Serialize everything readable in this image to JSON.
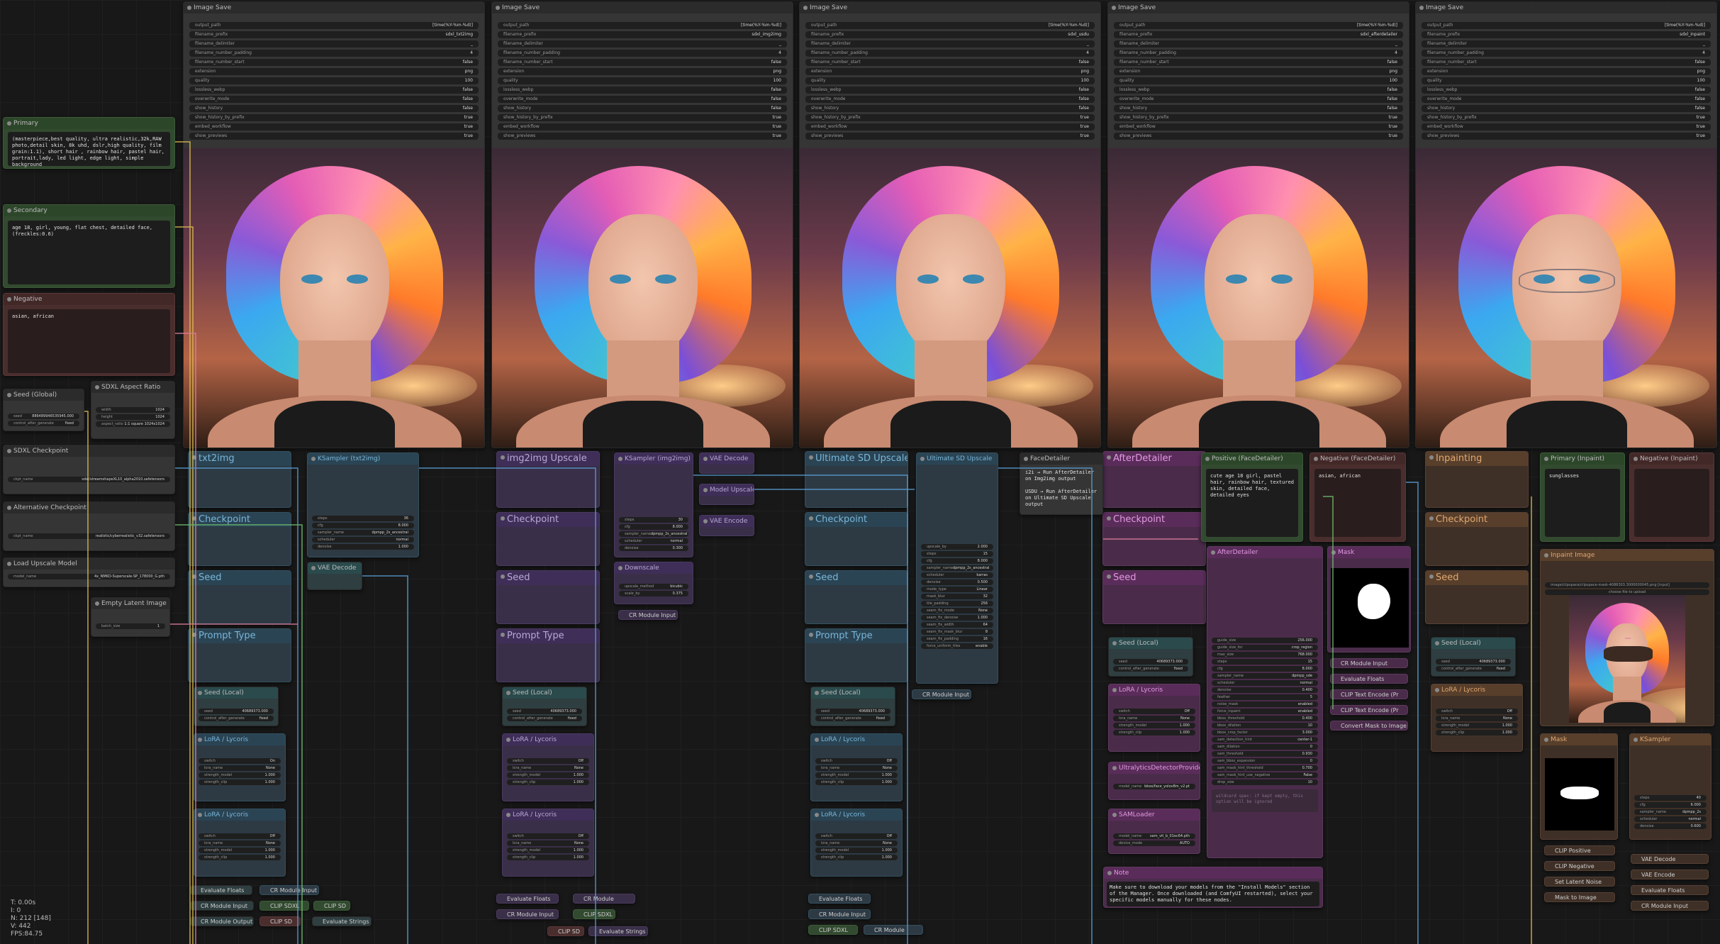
{
  "colors": {
    "canvas": "#181818",
    "link_yellow": "#e0c050",
    "link_blue": "#5aa0d8",
    "link_pink": "#e080a0",
    "link_green": "#70c070"
  },
  "image_saves": [
    {
      "title": "Image Save",
      "rows": [
        [
          "output_path",
          "[time(%Y-%m-%d)]"
        ],
        [
          "filename_prefix",
          "sdxl_txt2img"
        ],
        [
          "filename_delimiter",
          "_"
        ],
        [
          "filename_number_padding",
          "4"
        ],
        [
          "filename_number_start",
          "false"
        ],
        [
          "extension",
          "png"
        ],
        [
          "quality",
          "100"
        ],
        [
          "lossless_webp",
          "false"
        ],
        [
          "overwrite_mode",
          "false"
        ],
        [
          "show_history",
          "false"
        ],
        [
          "show_history_by_prefix",
          "true"
        ],
        [
          "embed_workflow",
          "true"
        ],
        [
          "show_previews",
          "true"
        ]
      ]
    },
    {
      "title": "Image Save",
      "rows": [
        [
          "output_path",
          "[time(%Y-%m-%d)]"
        ],
        [
          "filename_prefix",
          "sdxl_img2img"
        ],
        [
          "filename_delimiter",
          "_"
        ],
        [
          "filename_number_padding",
          "4"
        ],
        [
          "filename_number_start",
          "false"
        ],
        [
          "extension",
          "png"
        ],
        [
          "quality",
          "100"
        ],
        [
          "lossless_webp",
          "false"
        ],
        [
          "overwrite_mode",
          "false"
        ],
        [
          "show_history",
          "false"
        ],
        [
          "show_history_by_prefix",
          "true"
        ],
        [
          "embed_workflow",
          "true"
        ],
        [
          "show_previews",
          "true"
        ]
      ]
    },
    {
      "title": "Image Save",
      "rows": [
        [
          "output_path",
          "[time(%Y-%m-%d)]"
        ],
        [
          "filename_prefix",
          "sdxl_usdu"
        ],
        [
          "filename_delimiter",
          "_"
        ],
        [
          "filename_number_padding",
          "4"
        ],
        [
          "filename_number_start",
          "false"
        ],
        [
          "extension",
          "png"
        ],
        [
          "quality",
          "100"
        ],
        [
          "lossless_webp",
          "false"
        ],
        [
          "overwrite_mode",
          "false"
        ],
        [
          "show_history",
          "false"
        ],
        [
          "show_history_by_prefix",
          "true"
        ],
        [
          "embed_workflow",
          "true"
        ],
        [
          "show_previews",
          "true"
        ]
      ]
    },
    {
      "title": "Image Save",
      "rows": [
        [
          "output_path",
          "[time(%Y-%m-%d)]"
        ],
        [
          "filename_prefix",
          "sdxl_afterdetailer"
        ],
        [
          "filename_delimiter",
          "_"
        ],
        [
          "filename_number_padding",
          "4"
        ],
        [
          "filename_number_start",
          "false"
        ],
        [
          "extension",
          "png"
        ],
        [
          "quality",
          "100"
        ],
        [
          "lossless_webp",
          "false"
        ],
        [
          "overwrite_mode",
          "false"
        ],
        [
          "show_history",
          "false"
        ],
        [
          "show_history_by_prefix",
          "true"
        ],
        [
          "embed_workflow",
          "true"
        ],
        [
          "show_previews",
          "true"
        ]
      ]
    },
    {
      "title": "Image Save",
      "rows": [
        [
          "output_path",
          "[time(%Y-%m-%d)]"
        ],
        [
          "filename_prefix",
          "sdxl_inpaint"
        ],
        [
          "filename_delimiter",
          "_"
        ],
        [
          "filename_number_padding",
          "4"
        ],
        [
          "filename_number_start",
          "false"
        ],
        [
          "extension",
          "png"
        ],
        [
          "quality",
          "100"
        ],
        [
          "lossless_webp",
          "false"
        ],
        [
          "overwrite_mode",
          "false"
        ],
        [
          "show_history",
          "false"
        ],
        [
          "show_history_by_prefix",
          "true"
        ],
        [
          "embed_workflow",
          "true"
        ],
        [
          "show_previews",
          "true"
        ]
      ]
    }
  ],
  "prompts": {
    "primary": {
      "title": "Primary",
      "text": "(masterpiece,best quality, ultra realistic,32k,RAW photo,detail skin, 8k uhd, dslr,high quality, film grain:1.1), short hair , rainbow hair, pastel hair, portrait,lady, led light, edge light, simple background"
    },
    "secondary": {
      "title": "Secondary",
      "text": "age 18, girl, young, flat chest, detailed face, (freckles:0.6)"
    },
    "negative": {
      "title": "Negative",
      "text": "asian, african"
    }
  },
  "left_nodes": {
    "seed_global": {
      "title": "Seed (Global)",
      "rows": [
        [
          "seed",
          "886489946535945.000"
        ],
        [
          "control_after_generate",
          "fixed"
        ]
      ]
    },
    "aspect": {
      "title": "SDXL Aspect Ratio",
      "rows": [
        [
          "width",
          "1024"
        ],
        [
          "height",
          "1024"
        ],
        [
          "aspect_ratio",
          "1:1 square 1024x1024"
        ]
      ]
    },
    "checkpoint": {
      "title": "SDXL Checkpoint",
      "rows": [
        [
          "ckpt_name",
          "sdxl/streamshapeXL10_alpha2010.safetensors"
        ]
      ]
    },
    "alt_checkpoint": {
      "title": "Alternative Checkpoint",
      "rows": [
        [
          "ckpt_name",
          "realistic/cyberrealistic_v32.safetensors"
        ]
      ]
    },
    "upscale_model": {
      "title": "Load Upscale Model",
      "rows": [
        [
          "model_name",
          "4x_NMKD-Superscale-SP_178000_G.pth"
        ]
      ]
    },
    "empty_latent": {
      "title": "Empty Latent Image",
      "rows": [
        [
          "batch_size",
          "1"
        ]
      ]
    }
  },
  "groups": {
    "txt2img": "txt2img",
    "img2img": "img2img Upscale",
    "usdu": "Ultimate SD Upscale",
    "afterdetailer": "AfterDetailer",
    "inpainting": "Inpainting",
    "checkpoint": "Checkpoint",
    "seed": "Seed",
    "prompt_type": "Prompt Type"
  },
  "ksampler_txt2img": {
    "title": "KSampler (txt2img)",
    "rows": [
      [
        "steps",
        "36"
      ],
      [
        "cfg",
        "8.000"
      ],
      [
        "sampler_name",
        "dpmpp_2s_ancestral"
      ],
      [
        "scheduler",
        "normal"
      ],
      [
        "denoise",
        "1.000"
      ]
    ]
  },
  "ksampler_img2img": {
    "title": "KSampler (img2img)",
    "rows": [
      [
        "steps",
        "30"
      ],
      [
        "cfg",
        "8.000"
      ],
      [
        "sampler_name",
        "dpmpp_2s_ancestral"
      ],
      [
        "scheduler",
        "normal"
      ],
      [
        "denoise",
        "0.300"
      ]
    ]
  },
  "downscale": {
    "title": "Downscale",
    "rows": [
      [
        "upscale_method",
        "bicubic"
      ],
      [
        "scale_by",
        "0.375"
      ]
    ]
  },
  "usdu_node": {
    "title": "Ultimate SD Upscale",
    "rows": [
      [
        "upscale_by",
        "2.000"
      ],
      [
        "steps",
        "15"
      ],
      [
        "cfg",
        "8.000"
      ],
      [
        "sampler_name",
        "dpmpp_2s_ancestral"
      ],
      [
        "scheduler",
        "karras"
      ],
      [
        "denoise",
        "0.500"
      ],
      [
        "mode_type",
        "Linear"
      ],
      [
        "mask_blur",
        "32"
      ],
      [
        "tile_padding",
        "256"
      ],
      [
        "seam_fix_mode",
        "None"
      ],
      [
        "seam_fix_denoise",
        "1.000"
      ],
      [
        "seam_fix_width",
        "64"
      ],
      [
        "seam_fix_mask_blur",
        "8"
      ],
      [
        "seam_fix_padding",
        "16"
      ],
      [
        "force_uniform_tiles",
        "enable"
      ]
    ]
  },
  "facedetailer_note": {
    "title": "FaceDetailer",
    "text": "i2i → Run AfterDetailer on Img2img output\n\nUSDU → Run AfterDetailer on Ultimate SD Upscale output"
  },
  "ad_positive": {
    "title": "Positive (FaceDetailer)",
    "text": "cute age 18 girl, pastel hair, rainbow hair, textured skin, detailed face, detailed eyes"
  },
  "ad_negative": {
    "title": "Negative (FaceDetailer)",
    "text": "asian, african"
  },
  "ad_node": {
    "title": "AfterDetailer",
    "rows": [
      [
        "guide_size",
        "256.000"
      ],
      [
        "guide_size_for",
        "crop_region"
      ],
      [
        "max_size",
        "768.000"
      ],
      [
        "steps",
        "15"
      ],
      [
        "cfg",
        "8.000"
      ],
      [
        "sampler_name",
        "dpmpp_sde"
      ],
      [
        "scheduler",
        "normal"
      ],
      [
        "denoise",
        "0.400"
      ],
      [
        "feather",
        "5"
      ],
      [
        "noise_mask",
        "enabled"
      ],
      [
        "force_inpaint",
        "enabled"
      ],
      [
        "bbox_threshold",
        "0.400"
      ],
      [
        "bbox_dilation",
        "10"
      ],
      [
        "bbox_crop_factor",
        "3.000"
      ],
      [
        "sam_detection_hint",
        "center-1"
      ],
      [
        "sam_dilation",
        "0"
      ],
      [
        "sam_threshold",
        "0.930"
      ],
      [
        "sam_bbox_expansion",
        "0"
      ],
      [
        "sam_mask_hint_threshold",
        "0.700"
      ],
      [
        "sam_mask_hint_use_negative",
        "False"
      ],
      [
        "drop_size",
        "10"
      ]
    ],
    "wildcard": "wildcard spec: if kept empty, this option will be ignored"
  },
  "note_node": {
    "title": "Note",
    "text": "Make sure to download your models from the \"Install Models\" section of the Manager. Once downloaded (and ComfyUI restarted), select your specific models manually for these nodes."
  },
  "mask": {
    "title": "Mask"
  },
  "mask_outputs": [
    "CR Module Input",
    "Evaluate Floats",
    "CLIP Text Encode (Pr",
    "CLIP Text Encode (Pr",
    "Convert Mask to Image"
  ],
  "inpaint": {
    "primary_title": "Primary (Inpaint)",
    "primary_text": "sunglasses",
    "negative_title": "Negative (Inpaint)",
    "load_title": "Inpaint Image",
    "image_name": "image/clipspace/clipspace-mask-4086303.3000000045.png [input]",
    "upload": "choose file to upload",
    "mask_title": "Mask",
    "ksampler_title": "KSampler",
    "ksampler_rows": [
      [
        "steps",
        "40"
      ],
      [
        "cfg",
        "6.000"
      ],
      [
        "sampler_name",
        "dpmpp_2s"
      ],
      [
        "scheduler",
        "normal"
      ],
      [
        "denoise",
        "0.600"
      ]
    ],
    "outputs_left": [
      "CLIP Positive",
      "CLIP Negative",
      "Set Latent Noise Mas",
      "Mask to Image"
    ],
    "outputs_right": [
      "VAE Decode",
      "VAE Encode",
      "Evaluate Floats",
      "CR Module Input"
    ]
  },
  "seed_local": {
    "title": "Seed (Local)",
    "rows": [
      [
        "seed",
        "40689373.000"
      ],
      [
        "control_after_generate",
        "fixed"
      ]
    ]
  },
  "lora": {
    "title": "LoRA / Lycoris",
    "rows_on": [
      [
        "switch",
        "On"
      ],
      [
        "lora_name",
        "None"
      ],
      [
        "strength_model",
        "1.000"
      ],
      [
        "strength_clip",
        "1.000"
      ]
    ],
    "rows_off": [
      [
        "switch",
        "Off"
      ],
      [
        "lora_name",
        "None"
      ],
      [
        "strength_model",
        "1.000"
      ],
      [
        "strength_clip",
        "1.000"
      ]
    ]
  },
  "ultralytics": {
    "title": "UltralyticsDetectorProvider",
    "rows": [
      [
        "model_name",
        "bbox/face_yolov8m_v2.pt"
      ]
    ]
  },
  "samloader": {
    "title": "SAMLoader",
    "rows": [
      [
        "model_name",
        "sam_vit_b_01ec64.pth"
      ],
      [
        "device_mode",
        "AUTO"
      ]
    ]
  },
  "misc_labels": {
    "vae_decode": "VAE Decode",
    "model_upscale": "Model Upscale",
    "vae_encode": "VAE Encode",
    "cr_module_input": "CR Module Input",
    "evaluate_floats": "Evaluate Floats",
    "evaluate_strings": "Evaluate Strings",
    "clip_sdxl": "CLIP SDXL",
    "clip_sd": "CLIP SD",
    "cr_module_output": "CR Module Output"
  },
  "stats": "T: 0.00s\nI: 0\nN: 212 [148]\nV: 442\nFPS:84.75"
}
